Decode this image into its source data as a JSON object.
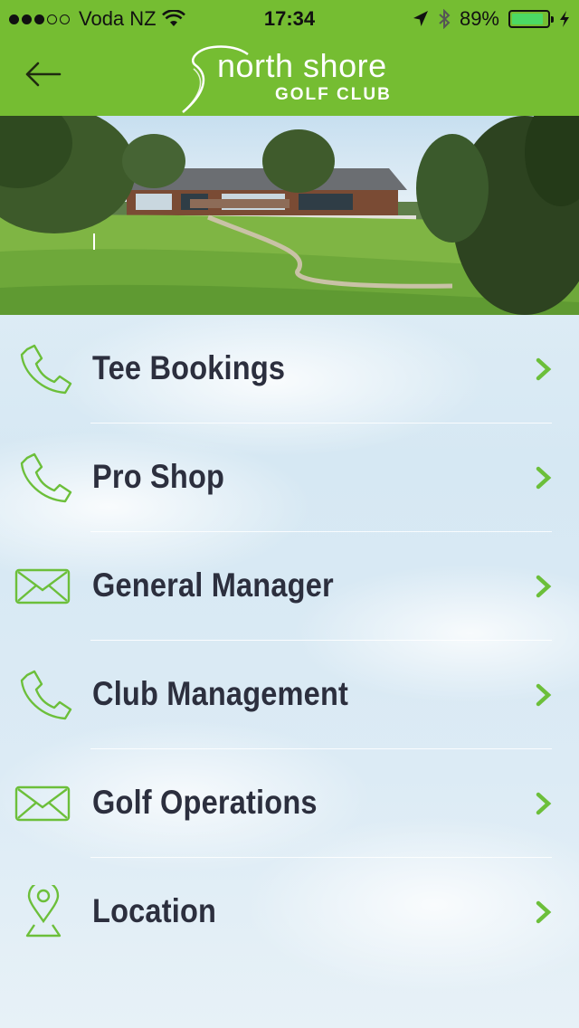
{
  "status_bar": {
    "carrier": "Voda NZ",
    "time": "17:34",
    "battery_percent": "89%",
    "battery_level": 0.89,
    "signal_bars_filled": 3,
    "signal_bars_total": 5
  },
  "header": {
    "logo_line1": "north shore",
    "logo_line2": "GOLF CLUB",
    "accent_color": "#75bd32"
  },
  "menu": {
    "items": [
      {
        "label": "Tee Bookings",
        "icon": "phone-icon"
      },
      {
        "label": "Pro Shop",
        "icon": "phone-icon"
      },
      {
        "label": "General Manager",
        "icon": "mail-icon"
      },
      {
        "label": "Club Management",
        "icon": "phone-icon"
      },
      {
        "label": "Golf Operations",
        "icon": "mail-icon"
      },
      {
        "label": "Location",
        "icon": "location-pin-icon"
      }
    ]
  }
}
